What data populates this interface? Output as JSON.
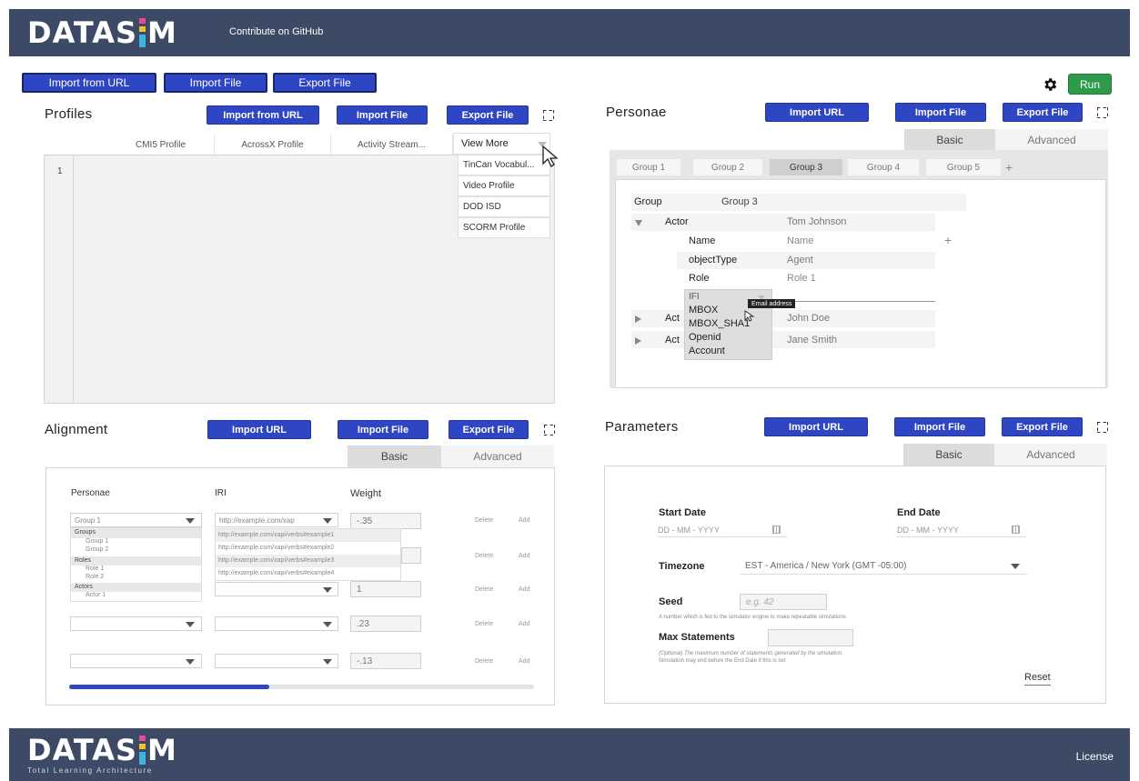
{
  "header": {
    "logo": "DATASIM",
    "github_link": "Contribute on GitHub"
  },
  "toolbar": {
    "import_url": "Import from URL",
    "import_file": "Import File",
    "export_file": "Export File",
    "run": "Run"
  },
  "profiles": {
    "title": "Profiles",
    "import_url": "Import from URL",
    "import_file": "Import File",
    "export_file": "Export File",
    "tabs": [
      "CMI5 Profile",
      "AcrossX Profile",
      "Activity Stream...",
      "View More"
    ],
    "line_number": "1",
    "menu": [
      "TinCan Vocabul...",
      "Video Profile",
      "DOD ISD",
      "SCORM Profile"
    ]
  },
  "personae": {
    "title": "Personae",
    "import_url": "Import URL",
    "import_file": "Import File",
    "export_file": "Export File",
    "basic": "Basic",
    "advanced": "Advanced",
    "groups": [
      "Group 1",
      "Group 2",
      "Group 3",
      "Group 4",
      "Group 5"
    ],
    "add_group": "+",
    "group_label": "Group",
    "group_value": "Group 3",
    "actor_label": "Actor",
    "actor_value": "Tom Johnson",
    "name_label": "Name",
    "name_value": "Name",
    "add_field": "+",
    "objecttype_label": "objectType",
    "objecttype_value": "Agent",
    "role_label": "Role",
    "role_value": "Role 1",
    "ifi_label": "IFI",
    "ifi_options": [
      "MBOX",
      "MBOX_SHA1",
      "Openid",
      "Account"
    ],
    "tooltip": "Email address",
    "actor2_label": "Act",
    "actor2_value": "John Doe",
    "actor3_label": "Act",
    "actor3_value": "Jane Smith"
  },
  "alignment": {
    "title": "Alignment",
    "import_url": "Import URL",
    "import_file": "Import File",
    "export_file": "Export File",
    "basic": "Basic",
    "advanced": "Advanced",
    "col_personae": "Personae",
    "col_iri": "IRI",
    "col_weight": "Weight",
    "row1_persona": "Group 1",
    "row1_iri": "http://example.com/xap",
    "row1_weight": "-.35",
    "persona_options": [
      "Groups",
      "Group 1",
      "Group 2",
      "Roles",
      "Role 1",
      "Role 2",
      "Actors",
      "Actor 1"
    ],
    "iri_options": [
      "http://example.com/xapi/verbs#example1",
      "http://example.com/xapi/verbs#example2",
      "http://example.com/xapi/verbs#example3",
      "http://example.com/xapi/verbs#example4"
    ],
    "weights": [
      "1",
      ".23",
      "-.13"
    ],
    "delete": "Delete",
    "add": "Add"
  },
  "parameters": {
    "title": "Parameters",
    "import_url": "Import URL",
    "import_file": "Import File",
    "export_file": "Export File",
    "basic": "Basic",
    "advanced": "Advanced",
    "start_date_label": "Start Date",
    "start_date_placeholder": "DD - MM - YYYY",
    "end_date_label": "End Date",
    "end_date_placeholder": "DD - MM - YYYY",
    "timezone_label": "Timezone",
    "timezone_value": "EST - America / New York (GMT -05:00)",
    "seed_label": "Seed",
    "seed_placeholder": "e.g. 42",
    "seed_help": "A number which is fed to the simulator engine to make repeatable simulations",
    "max_label": "Max Statements",
    "max_help1": "(Optional) The maximum number of statements generated by the simulation.",
    "max_help2": "Simulation may end before the End Date if this is set",
    "reset": "Reset"
  },
  "footer": {
    "logo": "DATASIM",
    "tagline": "Total Learning Architecture",
    "license": "License"
  },
  "colors": {
    "header_bg": "#3d4a65",
    "button": "#2f46c4",
    "run": "#2e9a4b"
  }
}
